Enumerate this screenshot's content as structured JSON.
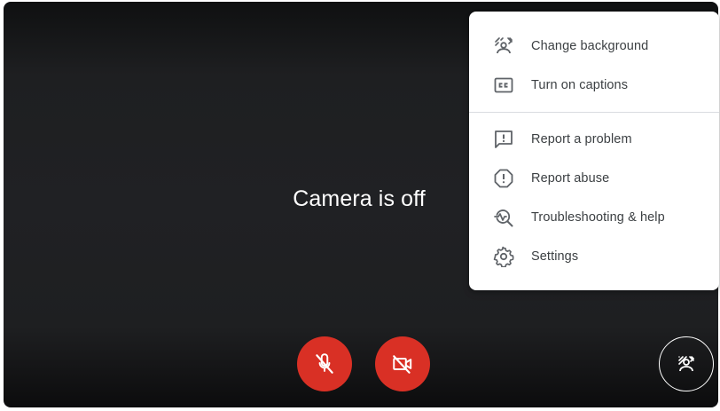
{
  "preview": {
    "status_text": "Camera is off"
  },
  "controls": {
    "mic": {
      "icon": "mic-off-icon",
      "state": "off",
      "color": "#d93025"
    },
    "camera": {
      "icon": "videocam-off-icon",
      "state": "off",
      "color": "#d93025"
    },
    "effects": {
      "icon": "background-effects-icon"
    }
  },
  "menu": {
    "group1": [
      {
        "label": "Change background",
        "icon": "background-replace-icon"
      },
      {
        "label": "Turn on captions",
        "icon": "closed-caption-icon"
      }
    ],
    "group2": [
      {
        "label": "Report a problem",
        "icon": "feedback-icon"
      },
      {
        "label": "Report abuse",
        "icon": "report-icon"
      },
      {
        "label": "Troubleshooting & help",
        "icon": "troubleshoot-icon"
      },
      {
        "label": "Settings",
        "icon": "settings-gear-icon"
      }
    ]
  }
}
